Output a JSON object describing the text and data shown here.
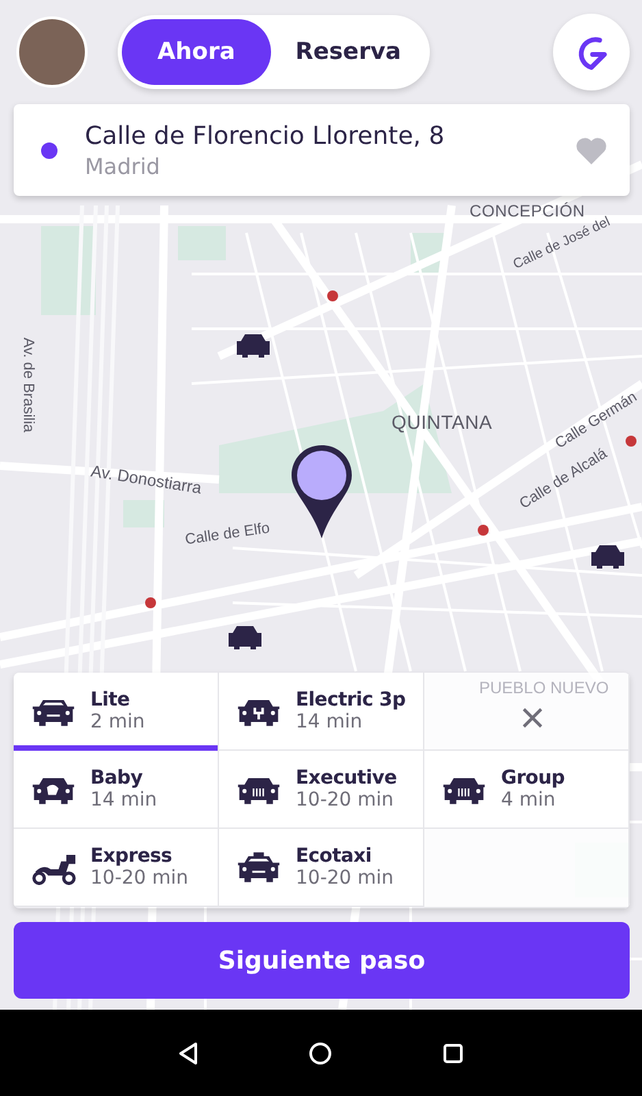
{
  "header": {
    "tabs": [
      {
        "label": "Ahora",
        "selected": true
      },
      {
        "label": "Reserva",
        "selected": false
      }
    ]
  },
  "address": {
    "street": "Calle de Florencio Llorente, 8",
    "city": "Madrid",
    "favorite": false
  },
  "map": {
    "labels": [
      "CONCEPCIÓN",
      "Calle de José del",
      "Av. de Brasilia",
      "QUINTANA",
      "Calle Germán",
      "Av. Donostiarra",
      "Calle de Alcalá",
      "Calle de Elfo",
      "PUEBLO NUEVO"
    ]
  },
  "vehicles": [
    {
      "kind": "car",
      "name": "Lite",
      "eta": "2 min",
      "selected": true
    },
    {
      "kind": "electric",
      "name": "Electric 3p",
      "eta": "14 min",
      "selected": false
    },
    {
      "kind": "baby",
      "name": "Baby",
      "eta": "14 min",
      "selected": false
    },
    {
      "kind": "executive",
      "name": "Executive",
      "eta": "10-20 min",
      "selected": false
    },
    {
      "kind": "group",
      "name": "Group",
      "eta": "4 min",
      "selected": false
    },
    {
      "kind": "scooter",
      "name": "Express",
      "eta": "10-20 min",
      "selected": false
    },
    {
      "kind": "taxi",
      "name": "Ecotaxi",
      "eta": "10-20 min",
      "selected": false
    }
  ],
  "next_button": "Siguiente paso"
}
